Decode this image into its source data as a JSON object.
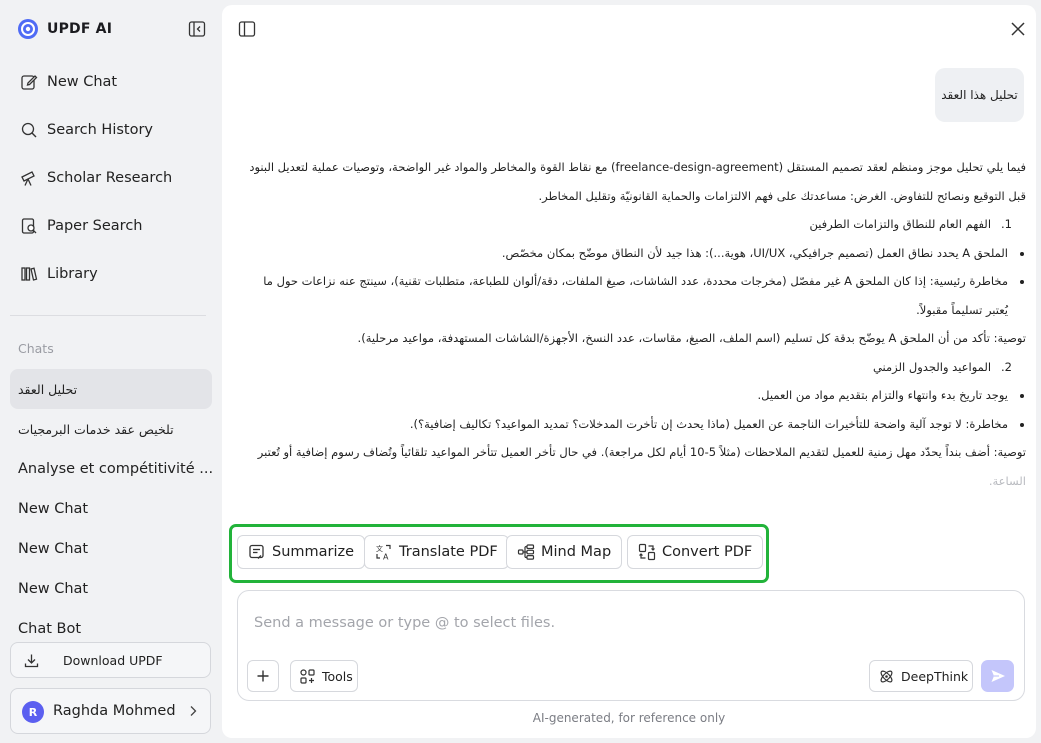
{
  "app": {
    "name": "UPDF AI"
  },
  "sidebar": {
    "nav": [
      {
        "label": "New Chat",
        "icon": "edit-icon"
      },
      {
        "label": "Search History",
        "icon": "search-icon"
      },
      {
        "label": "Scholar Research",
        "icon": "telescope-icon"
      },
      {
        "label": "Paper Search",
        "icon": "paper-search-icon"
      },
      {
        "label": "Library",
        "icon": "library-icon"
      }
    ],
    "chats_label": "Chats",
    "chats": [
      "تحليل العقد",
      "تلخيص عقد خدمات البرمجيات",
      "Analyse et compétitivité ...",
      "New Chat",
      "New Chat",
      "New Chat",
      "Chat Bot"
    ],
    "download_label": "Download UPDF",
    "user": {
      "initial": "R",
      "name": "Raghda Mohmed"
    }
  },
  "conversation": {
    "user_message": "تحليل هذا العقد",
    "answer": {
      "intro": "فيما يلي تحليل موجز ومنظم لعقد تصميم المستقل (freelance-design-agreement) مع نقاط القوة والمخاطر والمواد غير الواضحة، وتوصيات عملية لتعديل البنود قبل التوقيع ونصائح للتفاوض. الغرض: مساعدتك على فهم الالتزامات والحماية القانونيّة وتقليل المخاطر.",
      "section1_num": "1.",
      "section1_title": "الفهم العام للنطاق والتزامات الطرفين",
      "s1_bullet1": "الملحق A يحدد نطاق العمل (تصميم جرافيكي، UI/UX، هوية...): هذا جيد لأن النطاق موضّح بمكان مخصّص.",
      "s1_bullet2": "مخاطرة رئيسية: إذا كان الملحق A غير مفصّل (مخرجات محددة، عدد الشاشات، صيغ الملفات، دقة/ألوان للطباعة، متطلبات تقنية)، سينتج عنه نزاعات حول ما يُعتبر تسليماً مقبولاً.",
      "s1_rec": "توصية: تأكد من أن الملحق A يوضّح بدقة كل تسليم (اسم الملف، الصيغ، مقاسات، عدد النسخ، الأجهزة/الشاشات المستهدفة، مواعيد مرحلية).",
      "section2_num": "2.",
      "section2_title": "المواعيد والجدول الزمني",
      "s2_bullet1": "يوجد تاريخ بدء وانتهاء والتزام بتقديم مواد من العميل.",
      "s2_bullet2": "مخاطرة: لا توجد آلية واضحة للتأخيرات الناجمة عن العميل (ماذا يحدث إن تأخرت المدخلات؟ تمديد المواعيد؟ تكاليف إضافية؟).",
      "s2_rec": "توصية: أضف بنداً يحدّد مهل زمنية للعميل لتقديم الملاحظات (مثلاً 5-10 أيام لكل مراجعة). في حال تأخر العميل تتأخر المواعيد تلقائياً وتُضاف رسوم إضافية أو تُعتبر",
      "s2_rec_tail": "الساعة."
    }
  },
  "quick_actions": [
    {
      "label": "Summarize",
      "icon": "summarize-icon"
    },
    {
      "label": "Translate PDF",
      "icon": "translate-icon"
    },
    {
      "label": "Mind Map",
      "icon": "mind-map-icon"
    },
    {
      "label": "Convert PDF",
      "icon": "convert-icon"
    }
  ],
  "composer": {
    "placeholder": "Send a message or type @ to select files.",
    "tools_label": "Tools",
    "deepthink_label": "DeepThink"
  },
  "footnote": "AI-generated, for reference only",
  "colors": {
    "highlight_border": "#22b33a",
    "accent": "#5b5ff0",
    "send_disabled": "#c4c6fb"
  }
}
